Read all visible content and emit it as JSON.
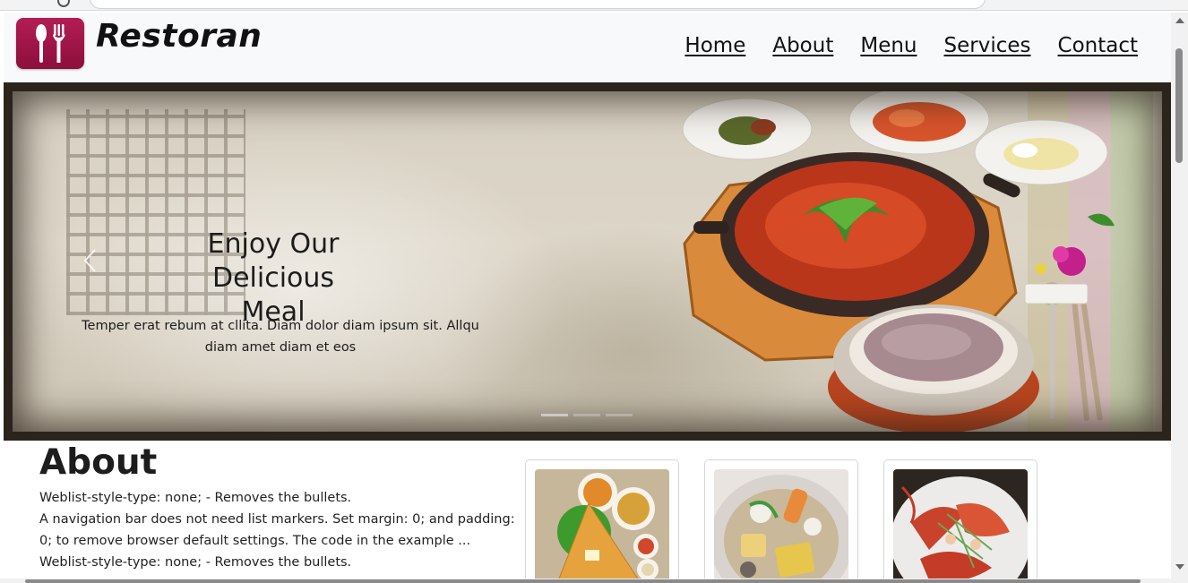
{
  "header": {
    "brand": "Restoran",
    "nav": [
      "Home",
      "About",
      "Menu",
      "Services",
      "Contact"
    ]
  },
  "hero": {
    "title_line1": "Enjoy Our",
    "title_line2": "Delicious Meal",
    "text": "Temper erat rebum at cllita. Diam dolor diam ipsum sit. Allqu diam amet diam et eos",
    "slide_count": 3,
    "active_slide": 1
  },
  "about": {
    "title": "About",
    "paragraphs": [
      "Weblist-style-type: none; - Removes the bullets.",
      "A navigation bar does not need list markers. Set margin: 0; and padding: 0; to remove browser default settings. The code in the example ...",
      "Weblist-style-type: none; - Removes the bullets."
    ]
  },
  "colors": {
    "brand_badge": "#9e1547",
    "header_bg": "#f7f9fa",
    "text": "#111111"
  },
  "icons": {
    "logo": "utensils-icon",
    "prev": "chevron-left-icon"
  }
}
